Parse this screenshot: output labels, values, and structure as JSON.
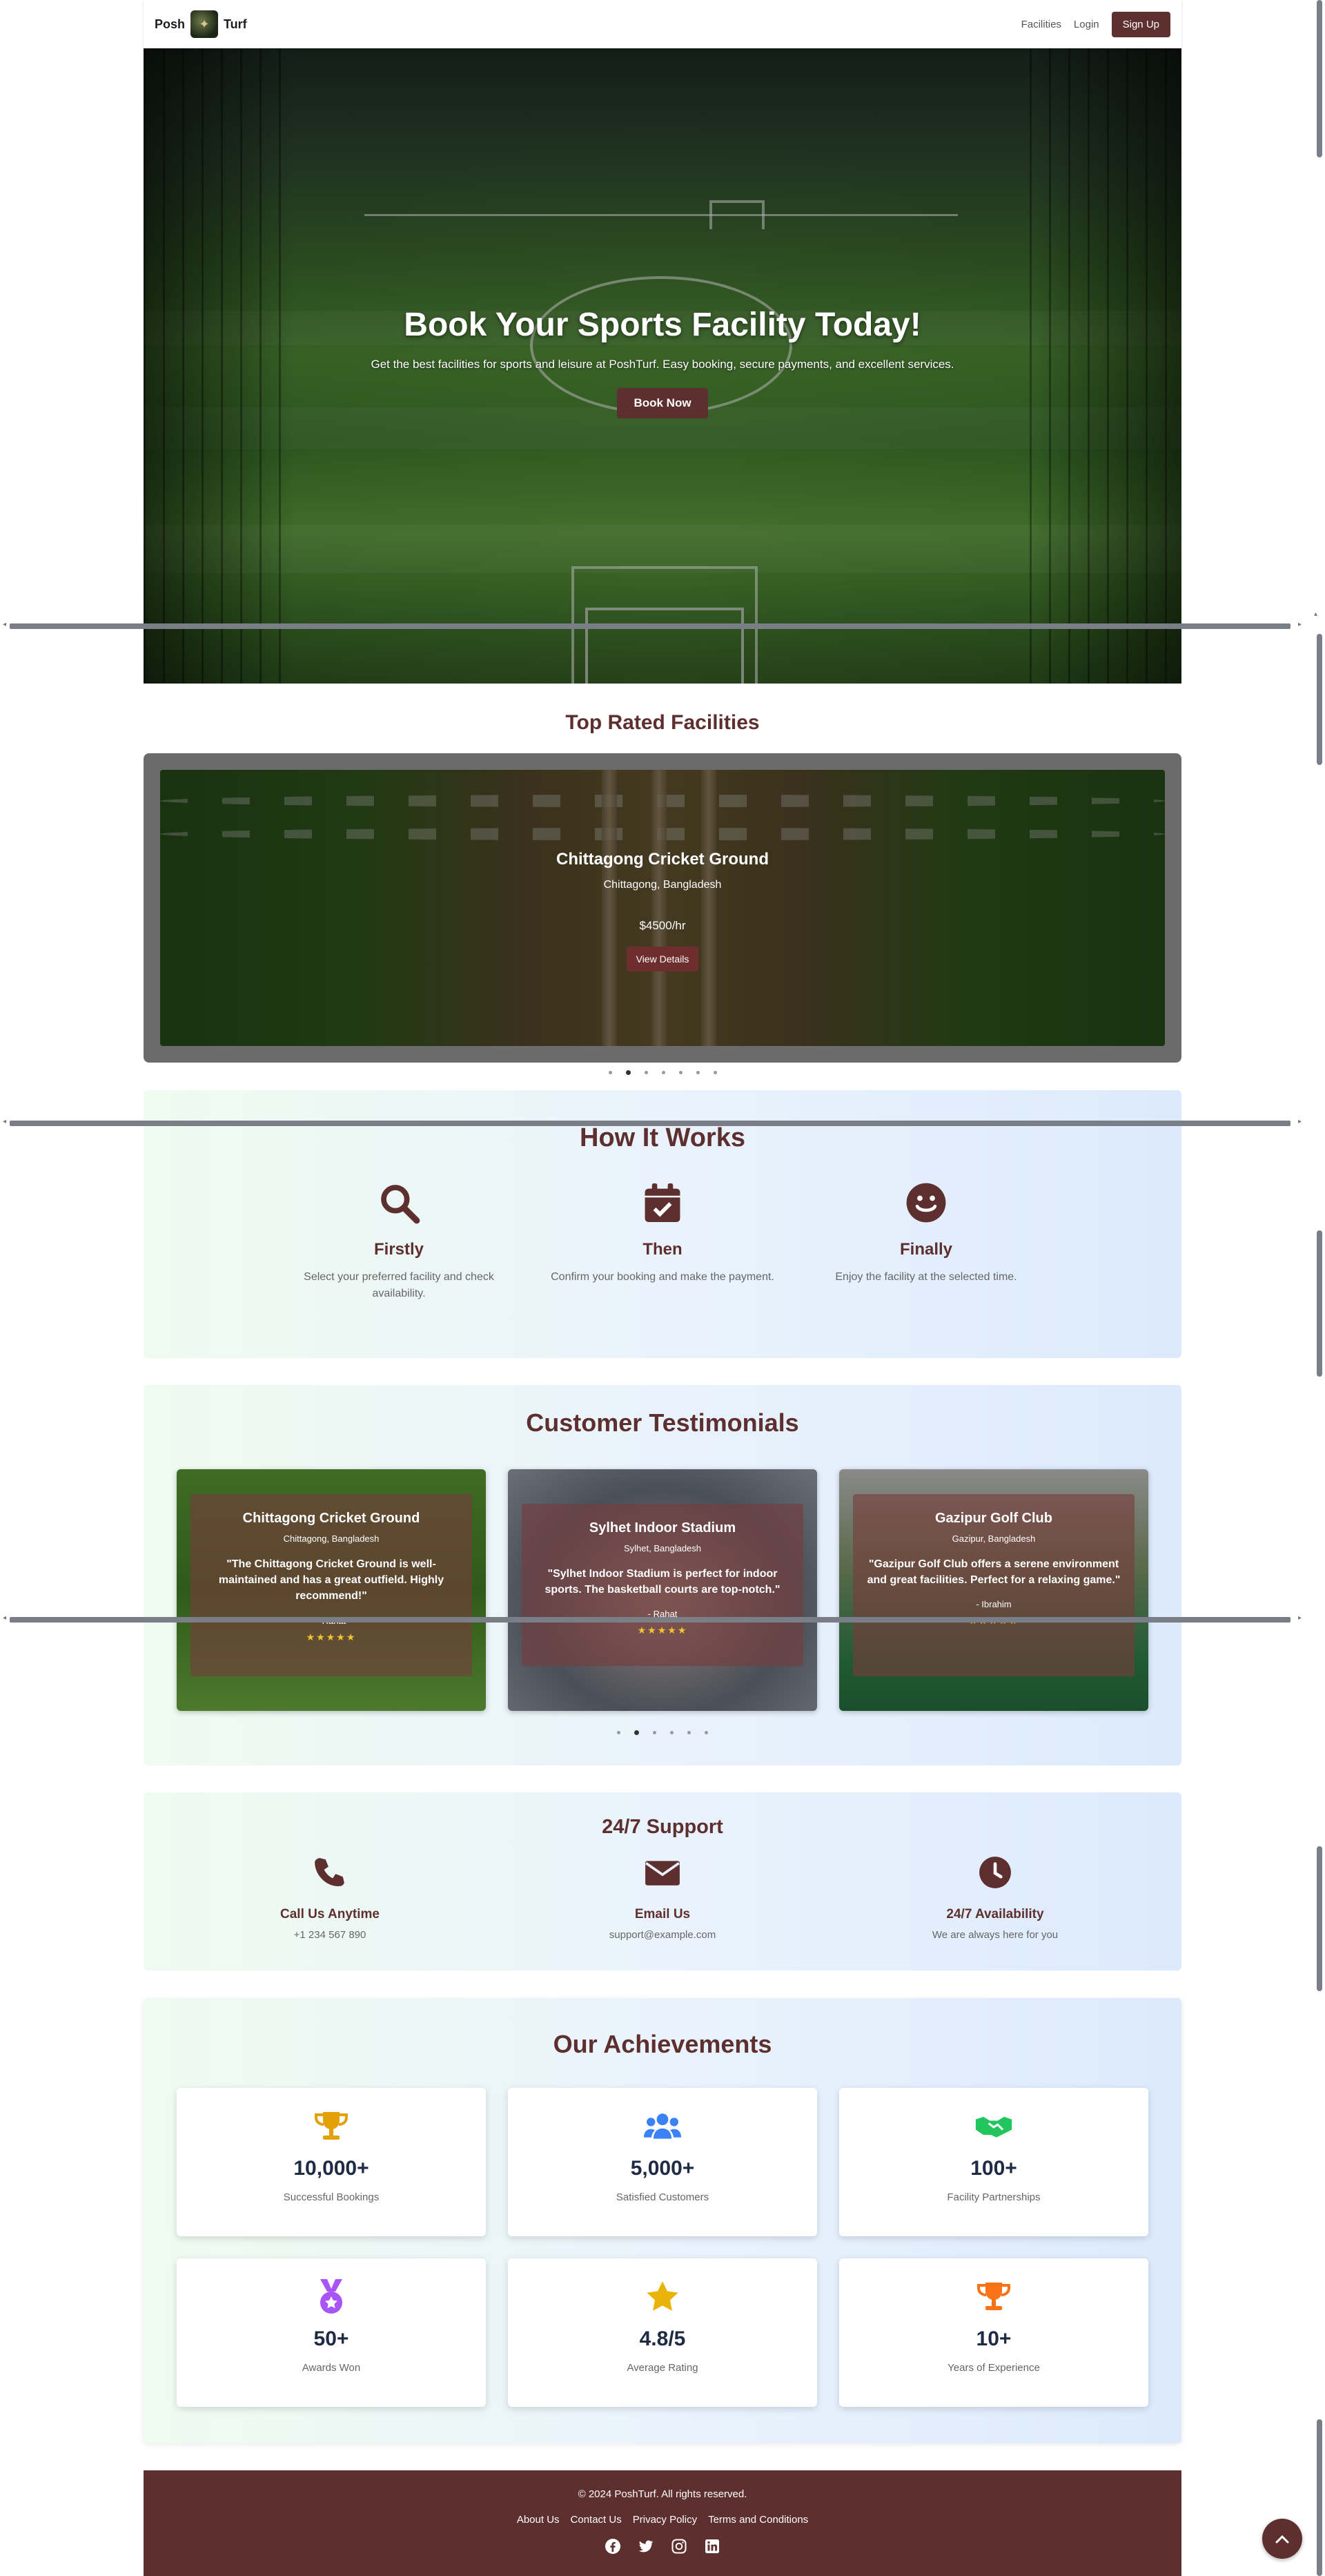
{
  "nav": {
    "brand_left": "Posh",
    "brand_right": "Turf",
    "links": [
      "Facilities",
      "Login"
    ],
    "signup": "Sign Up"
  },
  "hero": {
    "title": "Book Your Sports Facility Today!",
    "subtitle": "Get the best facilities for sports and leisure at PoshTurf. Easy booking, secure payments, and excellent services.",
    "cta": "Book Now"
  },
  "top_rated": {
    "title": "Top Rated Facilities",
    "slide": {
      "name": "Chittagong Cricket Ground",
      "location": "Chittagong, Bangladesh",
      "price": "$4500/hr",
      "button": "View Details"
    },
    "indicator_count": 7,
    "active_index": 1
  },
  "how": {
    "title": "How It Works",
    "steps": [
      {
        "icon": "search-icon",
        "title": "Firstly",
        "desc": "Select your preferred facility and check availability."
      },
      {
        "icon": "calendar-check-icon",
        "title": "Then",
        "desc": "Confirm your booking and make the payment."
      },
      {
        "icon": "smile-icon",
        "title": "Finally",
        "desc": "Enjoy the facility at the selected time."
      }
    ]
  },
  "testimonials": {
    "title": "Customer Testimonials",
    "cards": [
      {
        "name": "Chittagong Cricket Ground",
        "location": "Chittagong, Bangladesh",
        "quote": "\"The Chittagong Cricket Ground is well-maintained and has a great outfield. Highly recommend!\"",
        "author": "- Rahat",
        "stars": "★★★★★"
      },
      {
        "name": "Sylhet Indoor Stadium",
        "location": "Sylhet, Bangladesh",
        "quote": "\"Sylhet Indoor Stadium is perfect for indoor sports. The basketball courts are top-notch.\"",
        "author": "- Rahat",
        "stars": "★★★★★"
      },
      {
        "name": "Gazipur Golf Club",
        "location": "Gazipur, Bangladesh",
        "quote": "\"Gazipur Golf Club offers a serene environment and great facilities. Perfect for a relaxing game.\"",
        "author": "- Ibrahim",
        "stars": "★★★★★"
      }
    ],
    "indicator_count": 6,
    "active_index": 1
  },
  "support": {
    "title": "24/7 Support",
    "items": [
      {
        "icon": "phone-icon",
        "title": "Call Us Anytime",
        "sub": "+1 234 567 890"
      },
      {
        "icon": "envelope-icon",
        "title": "Email Us",
        "sub": "support@example.com"
      },
      {
        "icon": "clock-icon",
        "title": "24/7 Availability",
        "sub": "We are always here for you"
      }
    ]
  },
  "achievements": {
    "title": "Our Achievements",
    "items": [
      {
        "icon": "trophy-icon",
        "color": "#e3a008",
        "value": "10,000+",
        "label": "Successful Bookings"
      },
      {
        "icon": "users-icon",
        "color": "#3b82f6",
        "value": "5,000+",
        "label": "Satisfied Customers"
      },
      {
        "icon": "handshake-icon",
        "color": "#22c55e",
        "value": "100+",
        "label": "Facility Partnerships"
      },
      {
        "icon": "medal-icon",
        "color": "#a855f7",
        "value": "50+",
        "label": "Awards Won"
      },
      {
        "icon": "star-icon",
        "color": "#eab308",
        "value": "4.8/5",
        "label": "Average Rating"
      },
      {
        "icon": "trophy-icon",
        "color": "#f97316",
        "value": "10+",
        "label": "Years of Experience"
      }
    ]
  },
  "footer": {
    "copyright": "© 2024 PoshTurf. All rights reserved.",
    "links": [
      "About Us",
      "Contact Us",
      "Privacy Policy",
      "Terms and Conditions"
    ],
    "social": [
      "facebook-icon",
      "twitter-icon",
      "instagram-icon",
      "linkedin-icon"
    ]
  },
  "colors": {
    "brand": "#5e2f2f",
    "footer_bg": "#5e2f2f"
  }
}
